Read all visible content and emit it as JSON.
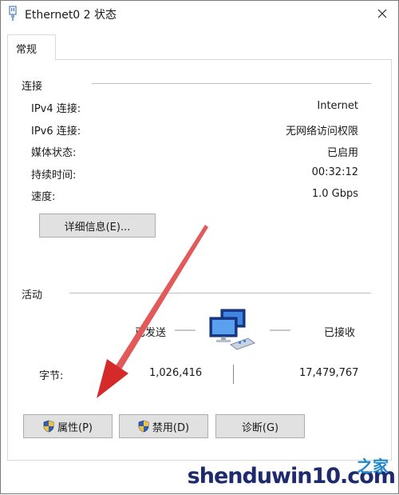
{
  "window": {
    "title": "Ethernet0 2 状态"
  },
  "tabs": [
    {
      "label": "常规",
      "selected": true
    }
  ],
  "connection": {
    "group_title": "连接",
    "rows": [
      {
        "label": "IPv4 连接:",
        "value": "Internet"
      },
      {
        "label": "IPv6 连接:",
        "value": "无网络访问权限"
      },
      {
        "label": "媒体状态:",
        "value": "已启用"
      },
      {
        "label": "持续时间:",
        "value": "00:32:12"
      },
      {
        "label": "速度:",
        "value": "1.0 Gbps"
      }
    ],
    "details_button": "详细信息(E)..."
  },
  "activity": {
    "group_title": "活动",
    "sent_label": "已发送",
    "received_label": "已接收",
    "bytes_label": "字节:",
    "bytes_sent": "1,026,416",
    "bytes_received": "17,479,767"
  },
  "buttons": {
    "properties": "属性(P)",
    "disable": "禁用(D)",
    "diagnose": "诊断(G)"
  },
  "watermark": {
    "text": "shenduwin10.com",
    "overlay_text": "之家"
  },
  "colors": {
    "button_bg": "#e1e1e1",
    "button_border": "#adadad",
    "arrow": "#d42a2a",
    "watermark": "#1e2a6e"
  }
}
